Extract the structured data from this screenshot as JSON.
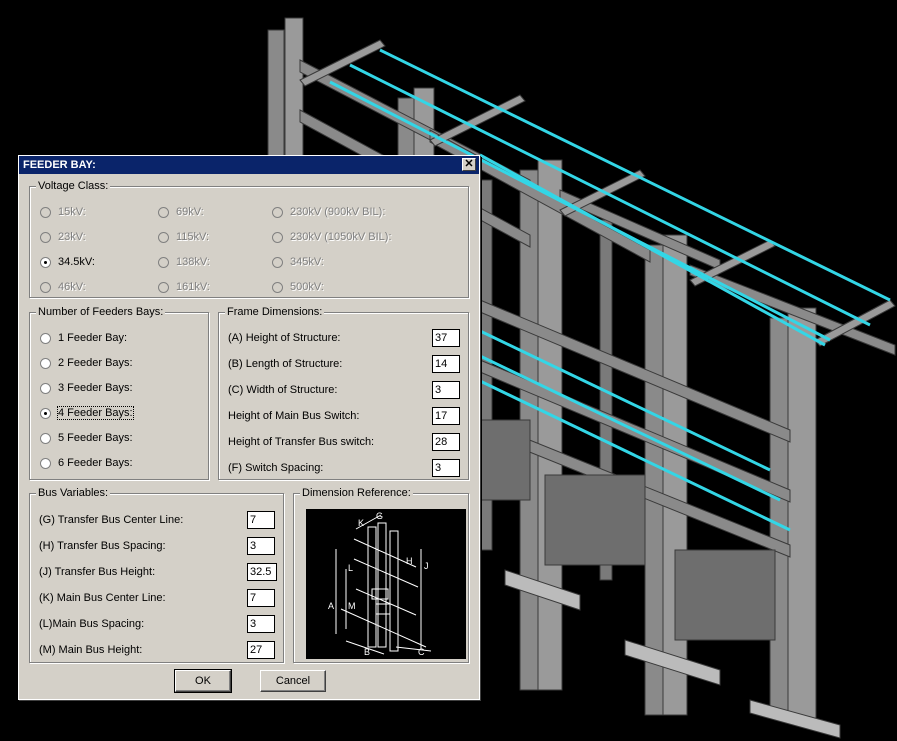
{
  "dialog": {
    "title": "FEEDER BAY:",
    "close_label": "✕"
  },
  "voltage_class": {
    "legend": "Voltage Class:",
    "options": [
      {
        "label": "15kV:",
        "selected": false,
        "enabled": false
      },
      {
        "label": "23kV:",
        "selected": false,
        "enabled": false
      },
      {
        "label": "34.5kV:",
        "selected": true,
        "enabled": true
      },
      {
        "label": "46kV:",
        "selected": false,
        "enabled": false
      },
      {
        "label": "69kV:",
        "selected": false,
        "enabled": false
      },
      {
        "label": "115kV:",
        "selected": false,
        "enabled": false
      },
      {
        "label": "138kV:",
        "selected": false,
        "enabled": false
      },
      {
        "label": "161kV:",
        "selected": false,
        "enabled": false
      },
      {
        "label": "230kV (900kV BIL):",
        "selected": false,
        "enabled": false
      },
      {
        "label": "230kV (1050kV BIL):",
        "selected": false,
        "enabled": false
      },
      {
        "label": "345kV:",
        "selected": false,
        "enabled": false
      },
      {
        "label": "500kV:",
        "selected": false,
        "enabled": false
      }
    ]
  },
  "feeders": {
    "legend": "Number of Feeders Bays:",
    "options": [
      {
        "label": "1 Feeder Bay:",
        "selected": false
      },
      {
        "label": "2 Feeder Bays:",
        "selected": false
      },
      {
        "label": "3 Feeder Bays:",
        "selected": false
      },
      {
        "label": "4 Feeder Bays:",
        "selected": true
      },
      {
        "label": "5 Feeder Bays:",
        "selected": false
      },
      {
        "label": "6 Feeder Bays:",
        "selected": false
      }
    ]
  },
  "frame": {
    "legend": "Frame Dimensions:",
    "fields": [
      {
        "label": "(A) Height of Structure:",
        "value": "37"
      },
      {
        "label": "(B) Length of Structure:",
        "value": "14"
      },
      {
        "label": "(C) Width of Structure:",
        "value": "3"
      },
      {
        "label": "Height of Main Bus Switch:",
        "value": "17"
      },
      {
        "label": "Height of Transfer Bus switch:",
        "value": "28"
      },
      {
        "label": "(F) Switch Spacing:",
        "value": "3"
      }
    ]
  },
  "bus": {
    "legend": "Bus Variables:",
    "fields": [
      {
        "label": "(G) Transfer Bus Center Line:",
        "value": "7"
      },
      {
        "label": "(H) Transfer Bus Spacing:",
        "value": "3"
      },
      {
        "label": "(J) Transfer Bus Height:",
        "value": "32.5"
      },
      {
        "label": "(K) Main Bus Center Line:",
        "value": "7"
      },
      {
        "label": "(L)Main Bus Spacing:",
        "value": "3"
      },
      {
        "label": "(M) Main Bus Height:",
        "value": "27"
      }
    ]
  },
  "dimref": {
    "legend": "Dimension Reference:",
    "letters": [
      "K",
      "G",
      "H",
      "J",
      "L",
      "M",
      "A",
      "B",
      "C"
    ]
  },
  "buttons": {
    "ok": "OK",
    "cancel": "Cancel"
  },
  "colors": {
    "bus_conductor": "#33d6e6",
    "steel": "#8a8a8a",
    "titlebar": "#0a246a"
  }
}
